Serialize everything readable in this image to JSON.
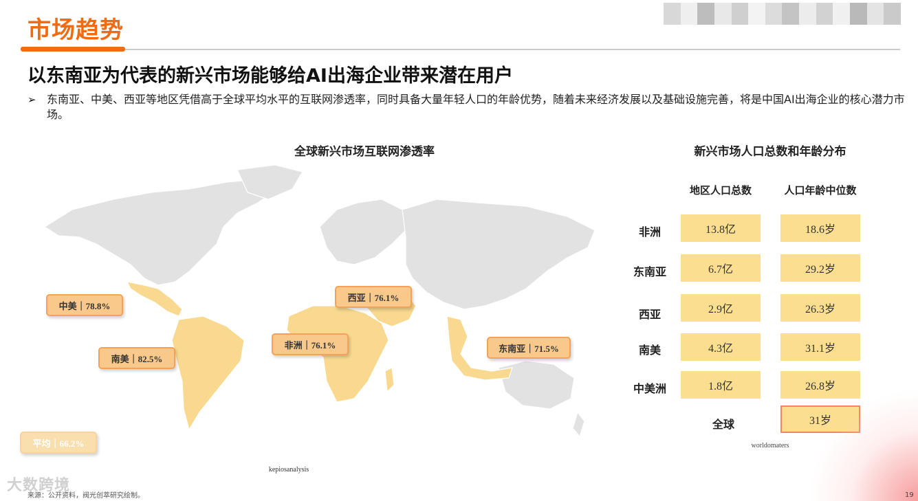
{
  "header": {
    "section_title": "市场趋势",
    "headline": "以东南亚为代表的新兴市场能够给AI出海企业带来潜在用户",
    "bullet_symbol": "➢",
    "description": "东南亚、中美、西亚等地区凭借高于全球平均水平的互联网渗透率，同时具备大量年轻人口的年龄优势，随着未来经济发展以及基础设施完善，将是中国AI出海企业的核心潜力市场。"
  },
  "colors": {
    "brand_orange": "#ef6c13",
    "map_base": "#e2e2e2",
    "map_highlight": "#f8d98f",
    "tag_fill": "#f8c98b",
    "cell_fill": "#fbde8f"
  },
  "map": {
    "title": "全球新兴市场互联网渗透率",
    "source": "kepiosanalysis",
    "tags": [
      {
        "id": "central-america",
        "label": "中美｜78.8%"
      },
      {
        "id": "south-america",
        "label": "南美｜82.5%"
      },
      {
        "id": "africa",
        "label": "非洲｜76.1%"
      },
      {
        "id": "west-asia",
        "label": "西亚｜76.1%"
      },
      {
        "id": "southeast-asia",
        "label": "东南亚｜71.5%"
      },
      {
        "id": "average",
        "label": "平均｜66.2%"
      }
    ]
  },
  "population_table": {
    "title": "新兴市场人口总数和年龄分布",
    "headers": [
      "地区人口总数",
      "人口年龄中位数"
    ],
    "rows": [
      {
        "region": "非洲",
        "population": "13.8亿",
        "median_age": "18.6岁"
      },
      {
        "region": "东南亚",
        "population": "6.7亿",
        "median_age": "29.2岁"
      },
      {
        "region": "西亚",
        "population": "2.9亿",
        "median_age": "26.3岁"
      },
      {
        "region": "南美",
        "population": "4.3亿",
        "median_age": "31.1岁"
      },
      {
        "region": "中美洲",
        "population": "1.8亿",
        "median_age": "26.8岁"
      }
    ],
    "global": {
      "label": "全球",
      "median_age": "31岁"
    },
    "source": "worldomaters"
  },
  "footer": {
    "source_note": "来源：公开资料，阀光创萃研究绘制。",
    "watermark": "大数跨境",
    "page_number": "19"
  }
}
